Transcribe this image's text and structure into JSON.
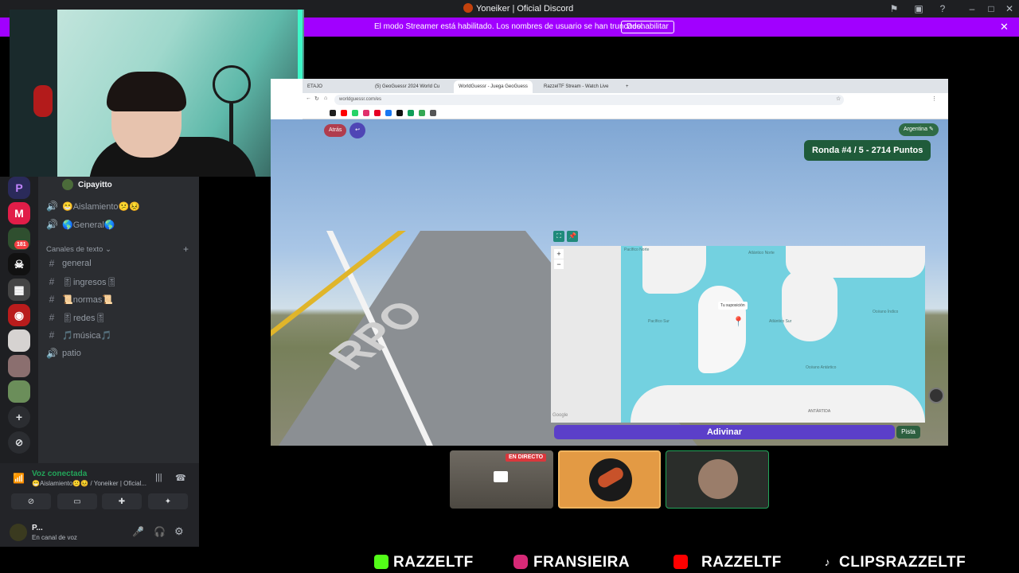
{
  "window": {
    "title": "Yoneiker | Oficial Discord"
  },
  "banner": {
    "text": "El modo Streamer está habilitado. Los nombres de usuario se han truncado.",
    "button": "Deshabilitar"
  },
  "servers": {
    "badge": "181"
  },
  "sidebar": {
    "voice_user": "Cipayitto",
    "voice_channels": [
      "😁Aislamiento😕😣",
      "🌎General🌎"
    ],
    "text_category": "Canales de texto",
    "text_channels": [
      "general",
      "🎚ingresos🎚",
      "📜normas📜",
      "🎚redes🎚",
      "🎵música🎵",
      "patio"
    ]
  },
  "voice_panel": {
    "status": "Voz conectada",
    "channel": "😁Aislamiento😕😣 / Yoneiker | Oficial...",
    "user_name": "P...",
    "user_status": "En canal de voz"
  },
  "browser": {
    "tabs": [
      "ETAJO",
      "(5) GeoGuessr 2024 World Cu",
      "WorldGuessr - Juega GeoGuess",
      "RazzelTF Stream - Watch Live"
    ],
    "url": "worldguessr.com/es",
    "back_label": "Atrás",
    "country_chip": "Argentina",
    "round": "Ronda #4 / 5 - 2714 Puntos",
    "map": {
      "labels": [
        "Pacífico Norte",
        "Atlántico Norte",
        "Pacífico Sur",
        "Atlántico Sur",
        "Océano Índico",
        "Océano Antártico",
        "ANTÁRTIDA",
        "Tu suposición",
        "Google"
      ],
      "zoom_in": "+",
      "zoom_out": "−"
    },
    "guess_button": "Adivinar",
    "hint_button": "Pista"
  },
  "tiles": {
    "live_badge": "EN DIRECTO"
  },
  "socials": [
    "RAZZELTF",
    "FRANSIEIRA",
    "RAZZELTF",
    "CLIPSRAZZELTF"
  ],
  "colors": {
    "streamer_banner": "#a100ff",
    "voice_green": "#23a55a",
    "guess_purple": "#5b3fc9"
  }
}
